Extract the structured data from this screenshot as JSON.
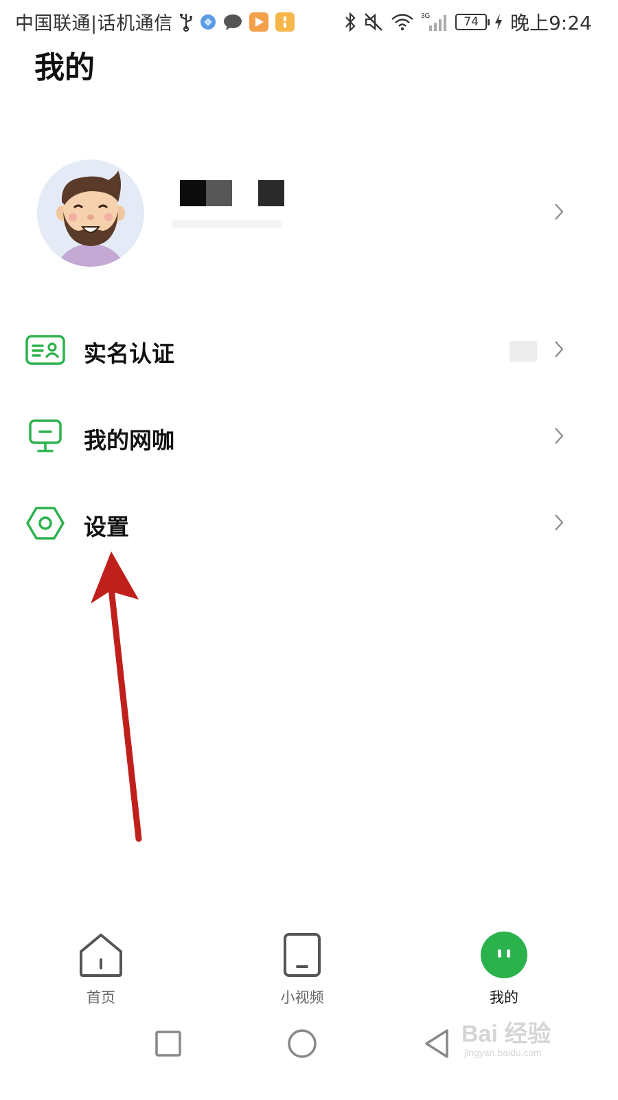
{
  "status_bar": {
    "carrier": "中国联通|话机通信",
    "network": "3G",
    "battery_level": "74",
    "time": "晚上9:24",
    "icons_left": [
      "usb-icon",
      "browser-app-icon",
      "message-app-icon",
      "video-app-icon",
      "notes-app-icon"
    ],
    "icons_right": [
      "bluetooth-icon",
      "mute-icon",
      "wifi-icon",
      "signal-icon",
      "battery-icon",
      "charging-icon"
    ]
  },
  "page": {
    "title": "我的"
  },
  "menu": [
    {
      "label": "实名认证",
      "icon": "id-card-icon"
    },
    {
      "label": "我的网咖",
      "icon": "monitor-icon"
    },
    {
      "label": "设置",
      "icon": "settings-hexagon-icon"
    }
  ],
  "bottom_nav": [
    {
      "label": "首页",
      "icon": "home-icon",
      "active": false
    },
    {
      "label": "小视频",
      "icon": "phone-video-icon",
      "active": false
    },
    {
      "label": "我的",
      "icon": "profile-face-icon",
      "active": true
    }
  ],
  "system_nav": [
    "recent-apps-icon",
    "home-circle-icon",
    "back-triangle-icon"
  ],
  "watermark": {
    "brand": "Bai 经验",
    "sub": "jingyan.baidu.com"
  },
  "colors": {
    "accent_green": "#2bb24c",
    "arrow_red": "#c0201b",
    "chevron": "#888888"
  }
}
